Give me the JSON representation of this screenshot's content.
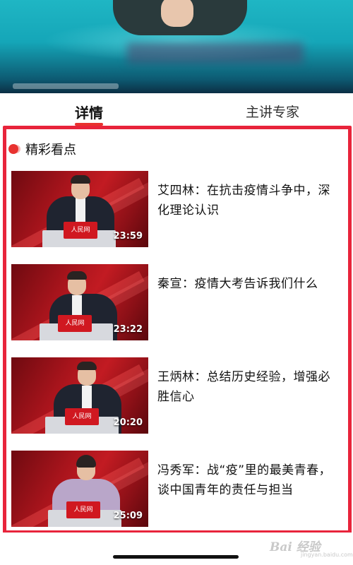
{
  "tabs": {
    "details_label": "详情",
    "experts_label": "主讲专家"
  },
  "section": {
    "title": "精彩看点"
  },
  "items": [
    {
      "title": "艾四林：在抗击疫情斗争中，深化理论认识",
      "duration": "23:59"
    },
    {
      "title": "秦宣：疫情大考告诉我们什么",
      "duration": "23:22"
    },
    {
      "title": "王炳林：总结历史经验，增强必胜信心",
      "duration": "20:20"
    },
    {
      "title": "冯秀军：战“疫”里的最美青春，谈中国青年的责任与担当",
      "duration": "25:09"
    }
  ],
  "podium_logo": "人民网",
  "watermark": {
    "main": "Bai 经验",
    "sub": "jingyan.baidu.com"
  },
  "colors": {
    "accent": "#e8322f",
    "highlight_border": "#e8243b"
  }
}
